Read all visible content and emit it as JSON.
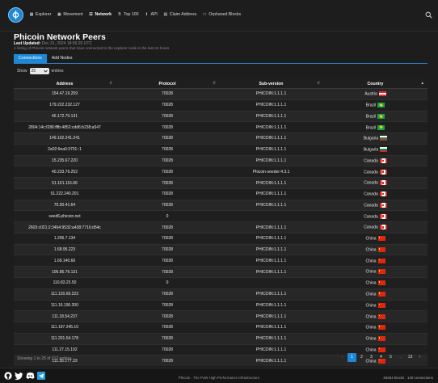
{
  "nav": {
    "items": [
      {
        "label": "Explorer",
        "icon": "cubes-icon",
        "glyph": "▦"
      },
      {
        "label": "Movement",
        "icon": "money-icon",
        "glyph": "▣"
      },
      {
        "label": "Network",
        "icon": "network-icon",
        "glyph": "☷"
      },
      {
        "label": "Top 100",
        "icon": "bitcoin-icon",
        "glyph": "B"
      },
      {
        "label": "API",
        "icon": "info-icon",
        "glyph": "ℹ"
      },
      {
        "label": "Claim Address",
        "icon": "card-icon",
        "glyph": "▤"
      },
      {
        "label": "Orphaned Blocks",
        "icon": "orphan-icon",
        "glyph": "□"
      }
    ],
    "active": "Network"
  },
  "page": {
    "title": "Phicoin Network Peers",
    "last_updated_label": "Last Updated:",
    "last_updated_value": "Dec 31, 2024 18:56:26 UTC",
    "description": "A listing of Phicoin network peers that have connected to the explorer node in the last 24 hours"
  },
  "tabs": [
    "Connections",
    "Add Nodes"
  ],
  "table_controls": {
    "show_label": "Show",
    "page_size": "25",
    "entries_label": "entries"
  },
  "table": {
    "columns": [
      "Address",
      "Protocol",
      "Sub-version",
      "Country"
    ],
    "rows": [
      {
        "address": "154.47.19.209",
        "protocol": "70028",
        "subversion": "PHICOIN:1.1.1.1",
        "country": "Austria",
        "flag": "austria"
      },
      {
        "address": "179.222.232.127",
        "protocol": "70028",
        "subversion": "PHICOIN:1.1.1.1",
        "country": "Brazil",
        "flag": "brazil"
      },
      {
        "address": "45.172.70.131",
        "protocol": "70028",
        "subversion": "PHICOIN:1.1.1.1",
        "country": "Brazil",
        "flag": "brazil"
      },
      {
        "address": "2804:14c:f286:fffb:4852:cdd6:b238:a547",
        "protocol": "70028",
        "subversion": "PHICOIN:1.1.1.1",
        "country": "Brazil",
        "flag": "brazil"
      },
      {
        "address": "149.102.241.241",
        "protocol": "70028",
        "subversion": "PHICOIN:1.1.1.1",
        "country": "Bulgaria",
        "flag": "bulgaria"
      },
      {
        "address": "2a02:6ea0:3701::1",
        "protocol": "70028",
        "subversion": "PHICOIN:1.1.1.1",
        "country": "Bulgaria",
        "flag": "bulgaria"
      },
      {
        "address": "15.235.67.220",
        "protocol": "70028",
        "subversion": "PHICOIN:1.1.1.1",
        "country": "Canada",
        "flag": "canada"
      },
      {
        "address": "40.233.76.252",
        "protocol": "70028",
        "subversion": "Phicoin-seeder:4.3.1",
        "country": "Canada",
        "flag": "canada"
      },
      {
        "address": "51.161.116.66",
        "protocol": "70028",
        "subversion": "PHICOIN:1.1.1.1",
        "country": "Canada",
        "flag": "canada"
      },
      {
        "address": "51.222.240.201",
        "protocol": "70028",
        "subversion": "PHICOIN:1.1.1.1",
        "country": "Canada",
        "flag": "canada"
      },
      {
        "address": "70.50.41.64",
        "protocol": "70028",
        "subversion": "PHICOIN:1.1.1.1",
        "country": "Canada",
        "flag": "canada"
      },
      {
        "address": "seed6.phicoin.net",
        "protocol": "0",
        "subversion": "",
        "country": "Canada",
        "flag": "canada"
      },
      {
        "address": "2603:c021:2:3464:9532:a438:7716:d54c",
        "protocol": "70028",
        "subversion": "PHICOIN:1.1.1.1",
        "country": "Canada",
        "flag": "canada"
      },
      {
        "address": "1.206.7.134",
        "protocol": "70028",
        "subversion": "PHICOIN:1.1.1.1",
        "country": "China",
        "flag": "china"
      },
      {
        "address": "1.68.95.223",
        "protocol": "70028",
        "subversion": "PHICOIN:1.1.1.1",
        "country": "China",
        "flag": "china"
      },
      {
        "address": "1.69.140.66",
        "protocol": "70028",
        "subversion": "PHICOIN:1.1.1.1",
        "country": "China",
        "flag": "china"
      },
      {
        "address": "106.85.76.131",
        "protocol": "70028",
        "subversion": "PHICOIN:1.1.1.1",
        "country": "China",
        "flag": "china"
      },
      {
        "address": "110.83.23.50",
        "protocol": "0",
        "subversion": "",
        "country": "China",
        "flag": "china"
      },
      {
        "address": "111.120.69.223",
        "protocol": "70028",
        "subversion": "PHICOIN:1.1.1.1",
        "country": "China",
        "flag": "china"
      },
      {
        "address": "111.16.190.200",
        "protocol": "70028",
        "subversion": "PHICOIN:1.1.1.1",
        "country": "China",
        "flag": "china"
      },
      {
        "address": "111.18.54.237",
        "protocol": "70028",
        "subversion": "PHICOIN:1.1.1.1",
        "country": "China",
        "flag": "china"
      },
      {
        "address": "111.197.245.10",
        "protocol": "70028",
        "subversion": "PHICOIN:1.1.1.1",
        "country": "China",
        "flag": "china"
      },
      {
        "address": "111.201.54.178",
        "protocol": "70028",
        "subversion": "PHICOIN:1.1.1.1",
        "country": "China",
        "flag": "china"
      },
      {
        "address": "111.27.15.192",
        "protocol": "70028",
        "subversion": "PHICOIN:1.1.1.1",
        "country": "China",
        "flag": "china"
      },
      {
        "address": "111.35.177.33",
        "protocol": "70028",
        "subversion": "PHICOIN:1.1.1.1",
        "country": "China",
        "flag": "china"
      }
    ]
  },
  "table_info": "Showing 1 to 25 of 312 entries",
  "pagination": {
    "prev": "‹",
    "pages": [
      "1",
      "2",
      "3",
      "4",
      "5"
    ],
    "ellipsis": "…",
    "last": "13",
    "next": "›",
    "current": "1"
  },
  "footer": {
    "text": "Phicoin - The PoW High Performance Infrastructure",
    "blocks": "84834 blocks",
    "connections": "120 connections",
    "social_icons": [
      "github-icon",
      "twitter-icon",
      "discord-icon",
      "telegram-icon"
    ]
  },
  "colors": {
    "accent": "#1e88d6",
    "background": "#1d1d1d"
  }
}
